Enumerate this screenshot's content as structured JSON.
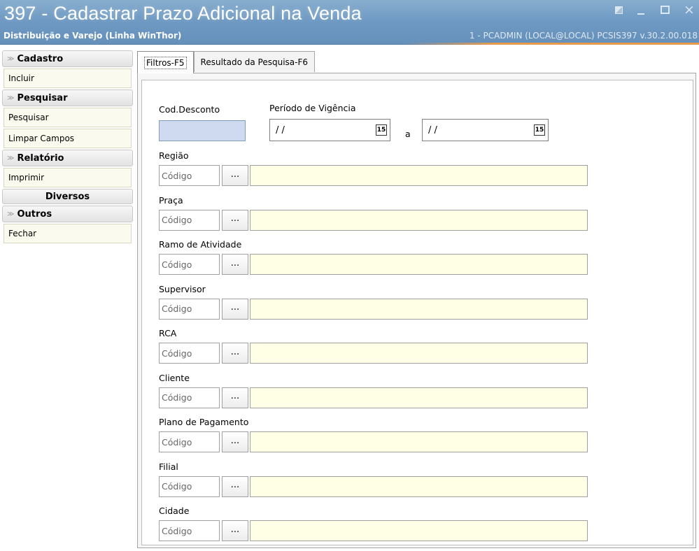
{
  "window": {
    "title": "397 - Cadastrar Prazo Adicional na Venda",
    "subtitle": "Distribuição e Varejo (Linha WinThor)",
    "user_info": "1 - PCADMIN (LOCAL@LOCAL)   PCSIS397  v.30.2.00.018",
    "close_glyph": "×"
  },
  "sidebar": {
    "chevron": "≫",
    "sections": [
      {
        "header": "Cadastro",
        "items": [
          "Incluir"
        ]
      },
      {
        "header": "Pesquisar",
        "items": [
          "Pesquisar",
          "Limpar Campos"
        ]
      },
      {
        "header": "Relatório",
        "items": [
          "Imprimir"
        ]
      },
      {
        "header": "Diversos",
        "items": []
      },
      {
        "header": "Outros",
        "items": [
          "Fechar"
        ]
      }
    ]
  },
  "tabs": [
    {
      "label": "Filtros-F5",
      "active": true
    },
    {
      "label": "Resultado da Pesquisa-F6",
      "active": false
    }
  ],
  "form": {
    "cod_desconto_label": "Cod.Desconto",
    "periodo_label": "Período de Vigência",
    "date_start_value": "/ /",
    "date_end_value": "/ /",
    "date_separator": "a",
    "calendar_glyph": "15",
    "code_placeholder": "Código",
    "lookup_button": "...",
    "filters": [
      "Região",
      "Praça",
      "Ramo de Atividade",
      "Supervisor",
      "RCA",
      "Cliente",
      "Plano de Pagamento",
      "Filial",
      "Cidade"
    ]
  },
  "colors": {
    "titlebar": "#6f9ac3",
    "accent_orange": "#e79a4c",
    "lookup_field_bg": "#ffffe6",
    "cod_desconto_bg": "#cfdaf0",
    "sidebar_item_bg": "#fafaee"
  }
}
